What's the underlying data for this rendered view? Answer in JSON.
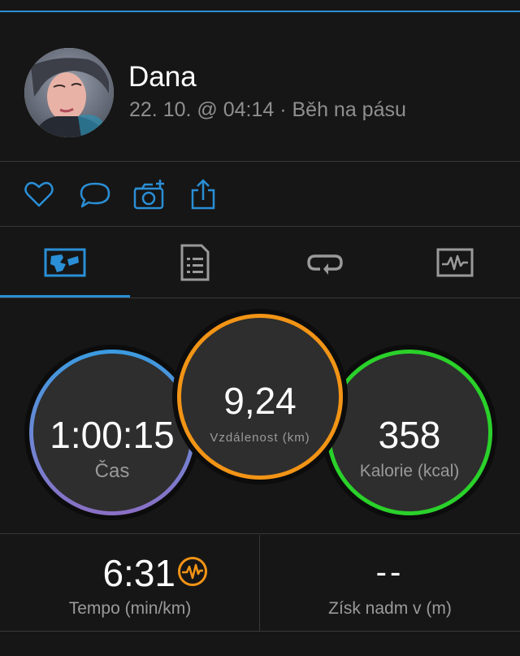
{
  "user": {
    "name": "Dana",
    "subtitle": "22. 10. @ 04:14 · Běh na pásu"
  },
  "actions": [
    {
      "icon": "heart-icon"
    },
    {
      "icon": "comment-icon"
    },
    {
      "icon": "add-photo-icon"
    },
    {
      "icon": "share-icon"
    }
  ],
  "tabs": [
    {
      "icon": "map-overview-icon",
      "active": true
    },
    {
      "icon": "details-icon",
      "active": false
    },
    {
      "icon": "laps-icon",
      "active": false
    },
    {
      "icon": "charts-icon",
      "active": false
    }
  ],
  "stats": {
    "time": {
      "value": "1:00:15",
      "label": "Čas"
    },
    "distance": {
      "value": "9,24",
      "label": "Vzdálenost (km)"
    },
    "calories": {
      "value": "358",
      "label": "Kalorie (kcal)"
    },
    "pace": {
      "value": "6:31",
      "label": "Tempo (min/km)"
    },
    "elevation": {
      "value": "--",
      "label": "Získ nadm v (m)"
    }
  },
  "colors": {
    "accent": "#2a8fd6",
    "distance_ring": "#f29416",
    "calories_ring": "#2ad12a",
    "time_ring_start": "#3a9be0",
    "time_ring_end": "#8a6fc4"
  }
}
